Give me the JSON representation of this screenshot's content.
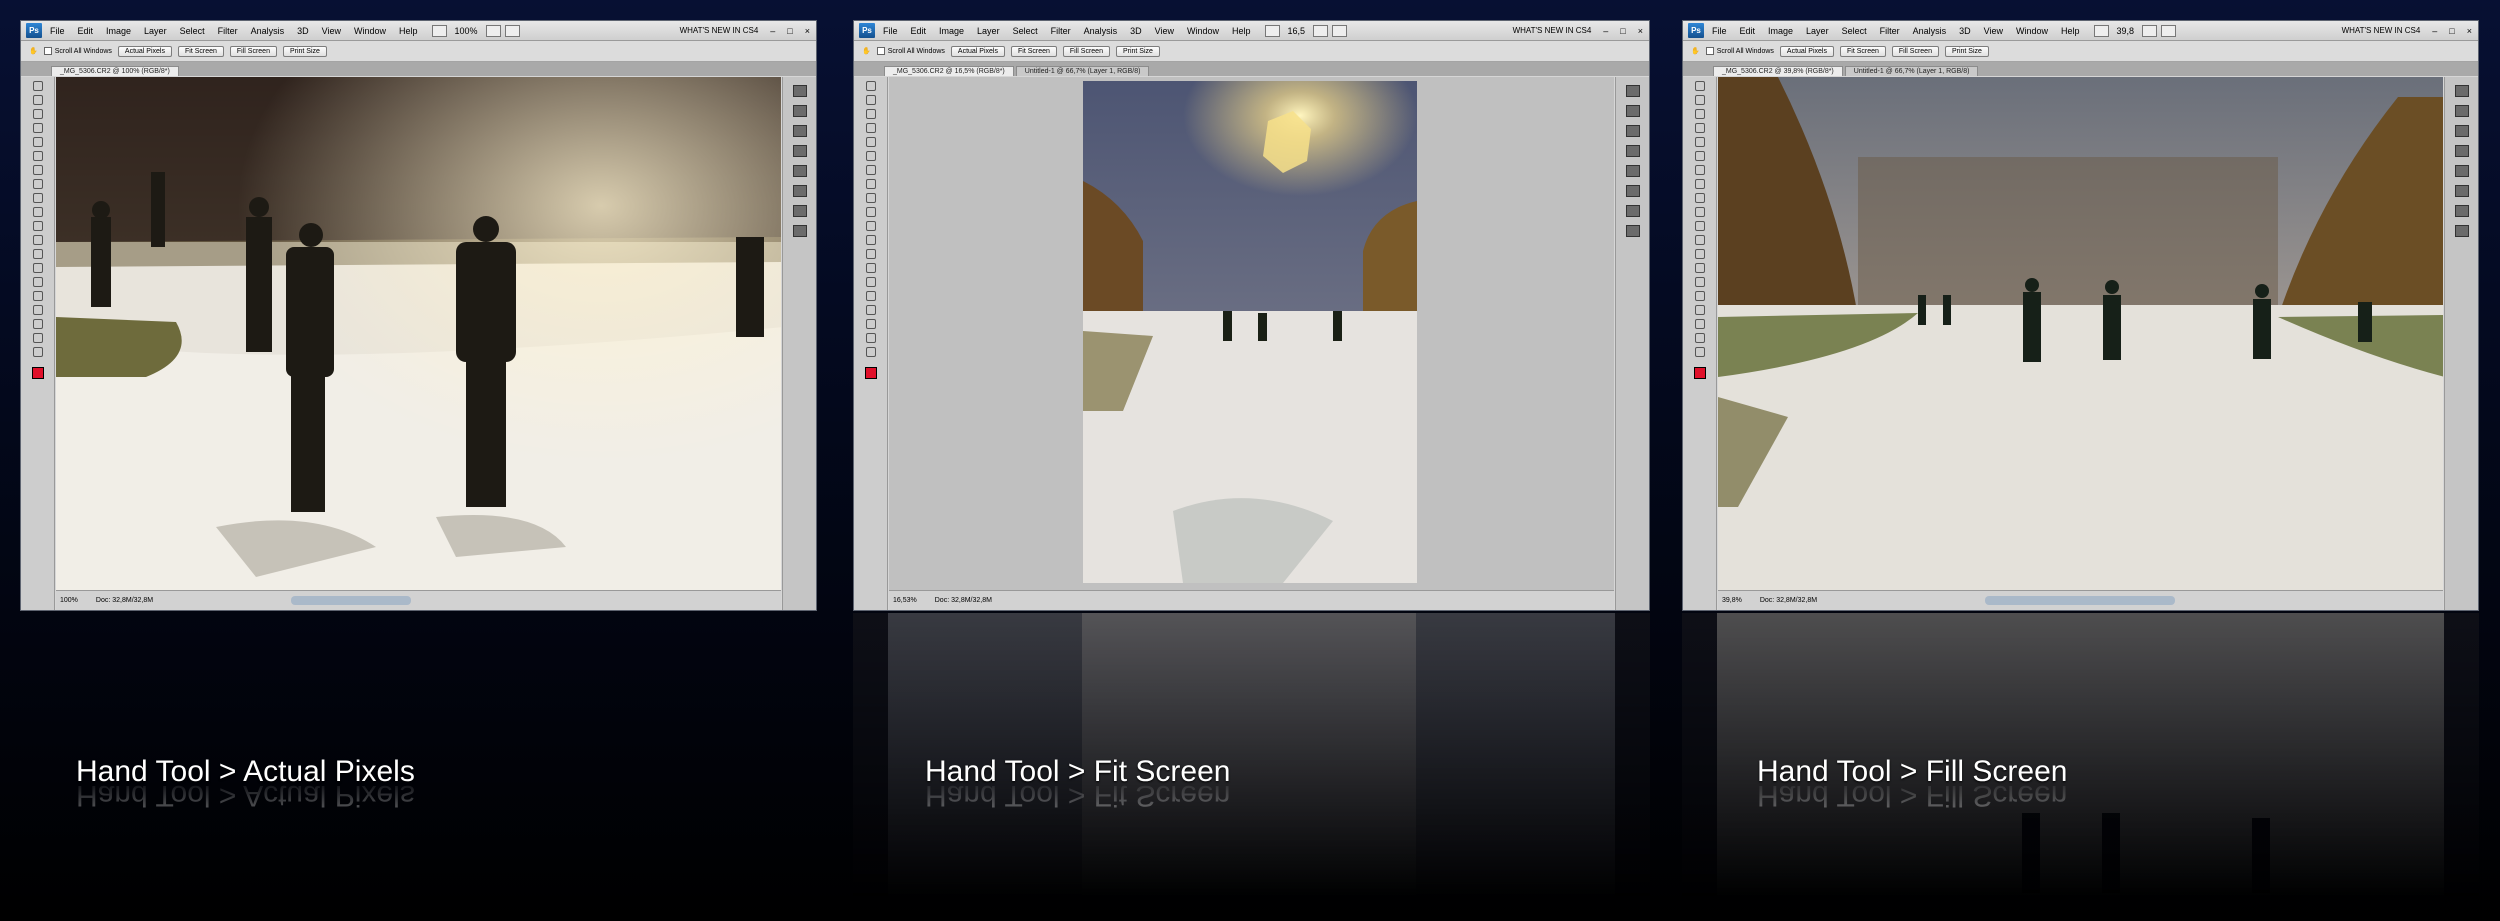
{
  "app_logo": "Ps",
  "menu": [
    "File",
    "Edit",
    "Image",
    "Layer",
    "Select",
    "Filter",
    "Analysis",
    "3D",
    "View",
    "Window",
    "Help"
  ],
  "whats_new": "WHAT'S NEW IN CS4",
  "options": {
    "scroll_all_windows": "Scroll All Windows",
    "actual_pixels": "Actual Pixels",
    "fit_screen": "Fit Screen",
    "fill_screen": "Fill Screen",
    "print_size": "Print Size"
  },
  "panels": [
    {
      "zoom_label": "100%",
      "tabs": [
        "_MG_5306.CR2 @ 100% (RGB/8*)"
      ],
      "status_zoom": "100%",
      "doc_info": "Doc: 32,8M/32,8M",
      "caption": "Hand Tool > Actual Pixels"
    },
    {
      "zoom_label": "16,5",
      "tabs": [
        "_MG_5306.CR2 @ 16,5% (RGB/8*)",
        "Untitled-1 @ 66,7% (Layer 1, RGB/8)"
      ],
      "status_zoom": "16,53%",
      "doc_info": "Doc: 32,8M/32,8M",
      "caption": "Hand Tool > Fit Screen"
    },
    {
      "zoom_label": "39,8",
      "tabs": [
        "_MG_5306.CR2 @ 39,8% (RGB/8*)",
        "Untitled-1 @ 66,7% (Layer 1, RGB/8)"
      ],
      "status_zoom": "39,8%",
      "doc_info": "Doc: 32,8M/32,8M",
      "caption": "Hand Tool > Fill Screen"
    }
  ],
  "colors": {
    "accent": "#2e86d6",
    "foreground": "#e0102a",
    "background_gradient_top": "#071033"
  }
}
